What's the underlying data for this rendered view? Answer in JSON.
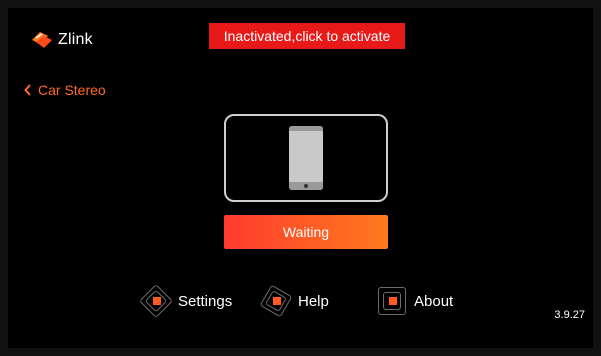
{
  "app": {
    "logo_text": "Zlink"
  },
  "banner": {
    "activate_text": "Inactivated,click to activate"
  },
  "back": {
    "label": "Car Stereo"
  },
  "connection": {
    "status_button": "Waiting"
  },
  "nav": {
    "settings": "Settings",
    "help": "Help",
    "about": "About"
  },
  "version": "3.9.27",
  "colors": {
    "accent": "#ff5a22",
    "banner": "#e81919",
    "background": "#000000"
  },
  "icons": [
    "zlink-logo-icon",
    "chevron-left-icon",
    "phone-icon",
    "settings-icon",
    "help-icon",
    "about-icon"
  ]
}
